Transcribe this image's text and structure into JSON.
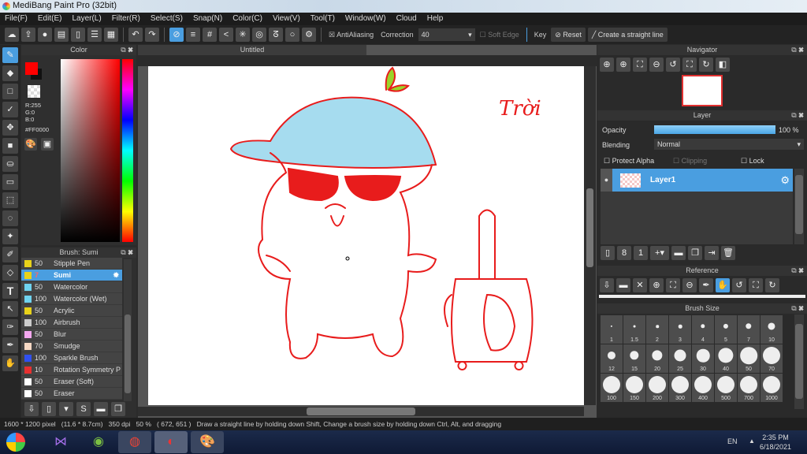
{
  "title": "MediBang Paint Pro (32bit)",
  "menu": [
    "File(F)",
    "Edit(E)",
    "Layer(L)",
    "Filter(R)",
    "Select(S)",
    "Snap(N)",
    "Color(C)",
    "View(V)",
    "Tool(T)",
    "Window(W)",
    "Cloud",
    "Help"
  ],
  "toolbar": {
    "antialiasing": "AntiAliasing",
    "correction_label": "Correction",
    "correction_value": "40",
    "soft_edge": "Soft Edge",
    "key": "Key",
    "reset": "Reset",
    "straight_line": "Create a straight line"
  },
  "color_panel": {
    "title": "Color",
    "r": "R:255",
    "g": "G:0",
    "b": "B:0",
    "hex": "#FF0000",
    "primary": "#ff0000",
    "secondary": "#000000"
  },
  "brush_panel": {
    "title": "Brush: Sumi",
    "items": [
      {
        "size": "50",
        "name": "Stipple Pen",
        "color": "#e8d21a"
      },
      {
        "size": "7",
        "name": "Sumi",
        "color": "#e8d21a",
        "selected": true
      },
      {
        "size": "50",
        "name": "Watercolor",
        "color": "#6fd3f0"
      },
      {
        "size": "100",
        "name": "Watercolor (Wet)",
        "color": "#6fd3f0"
      },
      {
        "size": "50",
        "name": "Acrylic",
        "color": "#e8d21a"
      },
      {
        "size": "100",
        "name": "Airbrush",
        "color": "#cccccc"
      },
      {
        "size": "50",
        "name": "Blur",
        "color": "#f4a8f0"
      },
      {
        "size": "70",
        "name": "Smudge",
        "color": "#f6d8c4"
      },
      {
        "size": "100",
        "name": "Sparkle Brush",
        "color": "#3050f0"
      },
      {
        "size": "10",
        "name": "Rotation Symmetry P",
        "color": "#e83030"
      },
      {
        "size": "50",
        "name": "Eraser (Soft)",
        "color": "#ffffff"
      },
      {
        "size": "50",
        "name": "Eraser",
        "color": "#ffffff"
      }
    ]
  },
  "document_tab": "Untitled",
  "canvas_text": "Trời",
  "navigator": {
    "title": "Navigator"
  },
  "layer_panel": {
    "title": "Layer",
    "opacity_label": "Opacity",
    "opacity_value": "100 %",
    "opacity": 100,
    "blending_label": "Blending",
    "blending_value": "Normal",
    "protect_alpha": "Protect Alpha",
    "clipping": "Clipping",
    "lock": "Lock",
    "layers": [
      "Layer1"
    ]
  },
  "reference": {
    "title": "Reference"
  },
  "brush_size": {
    "title": "Brush Size",
    "sizes": [
      "1",
      "1.5",
      "2",
      "3",
      "4",
      "5",
      "7",
      "10",
      "12",
      "15",
      "20",
      "25",
      "30",
      "40",
      "50",
      "70",
      "100",
      "150",
      "200",
      "300",
      "400",
      "500",
      "700",
      "1000"
    ]
  },
  "status": "1600 * 1200 pixel   (11.6 * 8.7cm)   350 dpi   50 %   ( 672, 651 )   Draw a straight line by holding down Shift, Change a brush size by holding down Ctrl, Alt, and dragging",
  "taskbar": {
    "lang": "EN",
    "time": "2:35 PM",
    "date": "6/18/2021"
  }
}
